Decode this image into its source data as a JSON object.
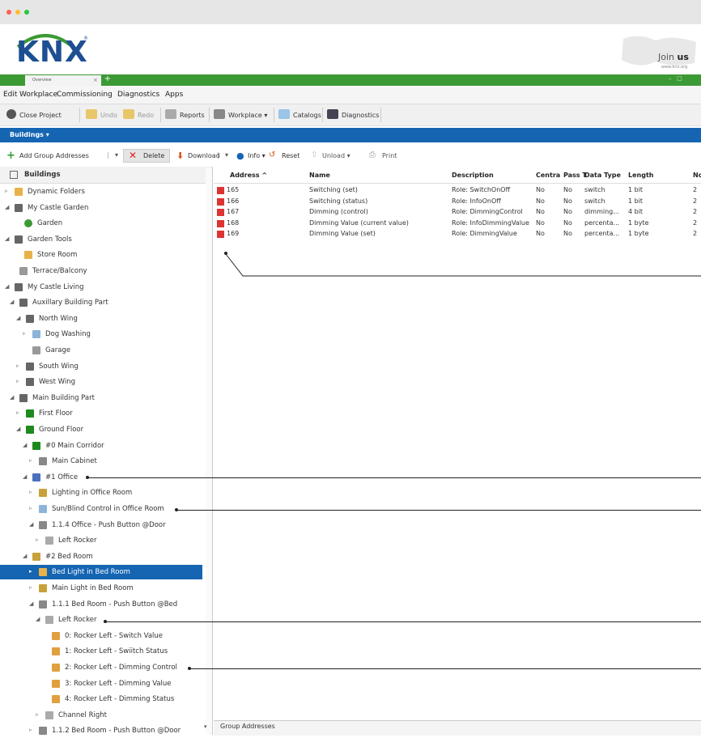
{
  "window": {
    "tab_title": "Overview",
    "brand_text": "KNX",
    "join_text_prefix": "Join ",
    "join_text_bold": "us",
    "join_url": "www.knx.org"
  },
  "menu": [
    "Edit",
    "Workplace",
    "Commissioning",
    "Diagnostics",
    "Apps"
  ],
  "toolbar1": {
    "close_project": "Close Project",
    "undo": "Undo",
    "redo": "Redo",
    "reports": "Reports",
    "workplace": "Workplace ▾",
    "catalogs": "Catalogs",
    "diagnostics": "Diagnostics"
  },
  "panel_title": "Buildings ▾",
  "toolbar2": {
    "add_group_addresses": "Add Group Addresses",
    "delete": "Delete",
    "download": "Download",
    "info": "Info ▾",
    "reset": "Reset",
    "unload": "Unload ▾",
    "print": "Print"
  },
  "tree": {
    "header": "Buildings",
    "items": [
      {
        "label": "Dynamic Folders",
        "icon": "folder-icon"
      },
      {
        "label": "My Castle Garden",
        "icon": "building-icon"
      },
      {
        "label": "Garden",
        "icon": "tree-icon"
      },
      {
        "label": "Garden Tools",
        "icon": "building-part-icon"
      },
      {
        "label": "Store Room",
        "icon": "room-icon"
      },
      {
        "label": "Terrace/Balcony",
        "icon": "terrace-icon"
      },
      {
        "label": "My Castle Living",
        "icon": "building-icon"
      },
      {
        "label": "Auxillary Building Part",
        "icon": "building-part-icon"
      },
      {
        "label": "North Wing",
        "icon": "building-part-icon"
      },
      {
        "label": "Dog Washing",
        "icon": "room-icon"
      },
      {
        "label": "Garage",
        "icon": "garage-icon"
      },
      {
        "label": "South Wing",
        "icon": "building-part-icon"
      },
      {
        "label": "West Wing",
        "icon": "building-part-icon"
      },
      {
        "label": "Main Building Part",
        "icon": "building-part-icon"
      },
      {
        "label": "First Floor",
        "icon": "floor-icon"
      },
      {
        "label": "Ground Floor",
        "icon": "floor-icon"
      },
      {
        "label": "#0 Main Corridor",
        "icon": "corridor-icon"
      },
      {
        "label": "Main Cabinet",
        "icon": "cabinet-icon"
      },
      {
        "label": "#1 Office",
        "icon": "office-icon"
      },
      {
        "label": "Lighting in Office Room",
        "icon": "light-icon"
      },
      {
        "label": "Sun/Blind Control in Office Room",
        "icon": "blind-icon"
      },
      {
        "label": "1.1.4 Office - Push Button @Door",
        "icon": "device-icon"
      },
      {
        "label": "Left Rocker",
        "icon": "rocker-icon"
      },
      {
        "label": "#2 Bed Room",
        "icon": "bedroom-icon"
      },
      {
        "label": "Bed Light in Bed Room",
        "icon": "light-icon"
      },
      {
        "label": "Main Light in Bed Room",
        "icon": "light-icon"
      },
      {
        "label": "1.1.1 Bed Room - Push Button @Bed",
        "icon": "device-icon"
      },
      {
        "label": "Left Rocker",
        "icon": "rocker-icon"
      },
      {
        "label": "0: Rocker Left - Switch Value",
        "icon": "object-icon"
      },
      {
        "label": "1: Rocker Left - Swiitch Status",
        "icon": "object-icon"
      },
      {
        "label": "2: Rocker Left - Dimming Control",
        "icon": "object-icon"
      },
      {
        "label": "3: Rocker Left - Dimming Value",
        "icon": "object-icon"
      },
      {
        "label": "4: Rocker Left - Dimming Status",
        "icon": "object-icon"
      },
      {
        "label": "Channel Right",
        "icon": "rocker-icon"
      },
      {
        "label": "1.1.2 Bed Room - Push Button @Door",
        "icon": "device-icon"
      }
    ]
  },
  "table": {
    "headers": [
      "Address ^",
      "Name",
      "Description",
      "Centra",
      "Pass T",
      "Data Type",
      "Length",
      "No"
    ],
    "rows": [
      [
        "165",
        "Switching (set)",
        "Role: SwitchOnOff",
        "No",
        "No",
        "switch",
        "1 bit",
        "2"
      ],
      [
        "166",
        "Switching (status)",
        "Role: InfoOnOff",
        "No",
        "No",
        "switch",
        "1 bit",
        "2"
      ],
      [
        "167",
        "Dimming (control)",
        "Role: DimmingControl",
        "No",
        "No",
        "dimming...",
        "4 bit",
        "2"
      ],
      [
        "168",
        "Dimming Value (current value)",
        "Role: InfoDimmingValue",
        "No",
        "No",
        "percenta...",
        "1 byte",
        "2"
      ],
      [
        "169",
        "Dimming Value (set)",
        "Role: DimmingValue",
        "No",
        "No",
        "percenta...",
        "1 byte",
        "2"
      ]
    ]
  },
  "bottom_tab": "Group Addresses",
  "colors": {
    "accent_blue": "#1565b3",
    "knx_green": "#3c9a35",
    "knx_blue": "#1e4f93"
  }
}
